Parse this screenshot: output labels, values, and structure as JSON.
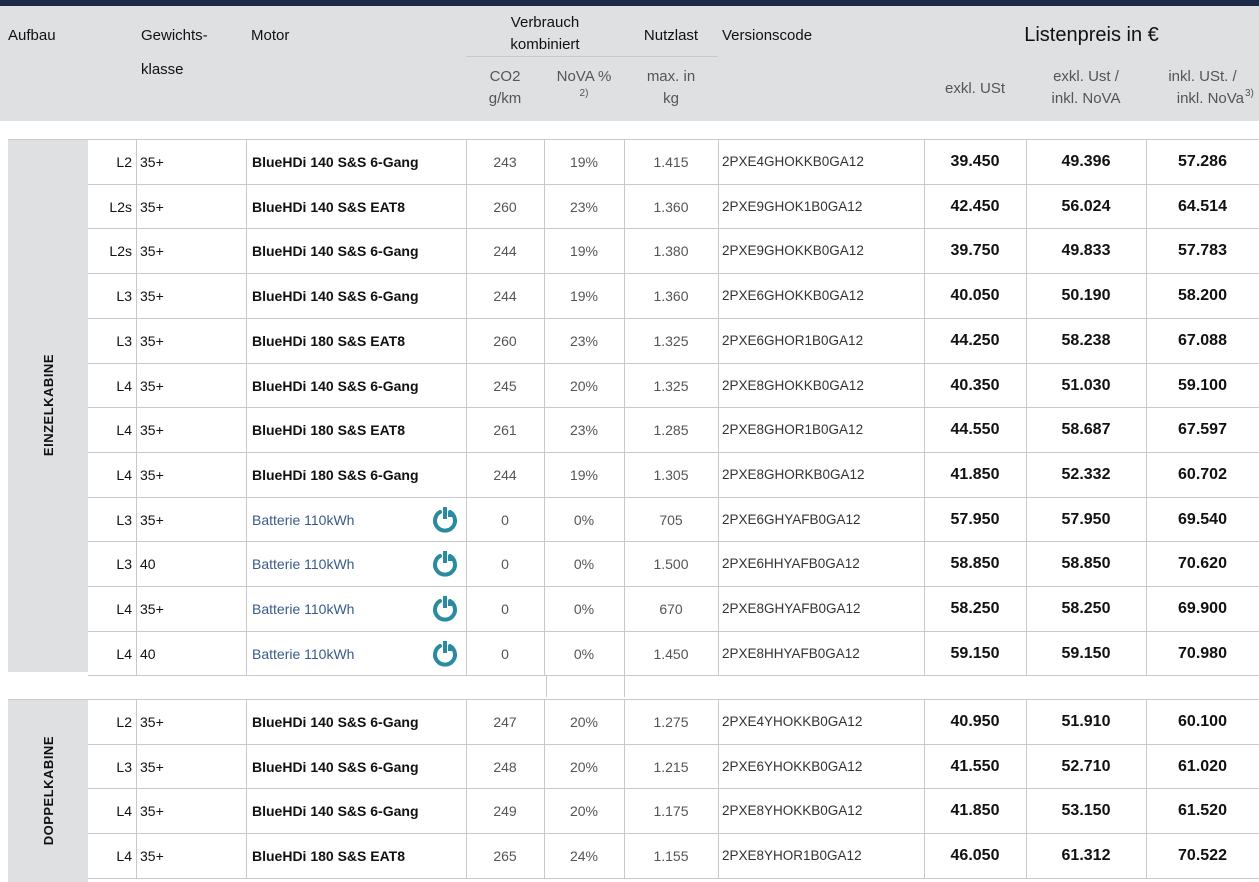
{
  "header": {
    "aufbau": "Aufbau",
    "gewichtsklasse_1": "Gewichts-",
    "gewichtsklasse_2": "klasse",
    "motor": "Motor",
    "verbrauch_1": "Verbrauch",
    "verbrauch_2": "kombiniert",
    "co2_1": "CO2",
    "co2_2": "g/km",
    "nova_1": "NoVA %",
    "nova_sup": "2)",
    "nutzlast": "Nutzlast",
    "nutzlast_sub_1": "max. in",
    "nutzlast_sub_2": "kg",
    "versionscode": "Versionscode",
    "listenpreis": "Listenpreis in €",
    "exkl_ust": "exkl. USt",
    "exkl_ust_inkl_nova_1": "exkl. Ust /",
    "exkl_ust_inkl_nova_2": "inkl. NoVA",
    "inkl_ust_inkl_nova_1": "inkl. USt. /",
    "inkl_ust_inkl_nova_2": "inkl. NoVa",
    "inkl_sup": "3)"
  },
  "sections": [
    {
      "label": "EINZELKABINE",
      "rows": [
        {
          "len": "L2",
          "class": "35+",
          "motor": "BlueHDi 140 S&S 6-Gang",
          "electric": false,
          "co2": "243",
          "nova": "19%",
          "payload": "1.415",
          "code": "2PXE4GHOKKB0GA12",
          "p1": "39.450",
          "p2": "49.396",
          "p3": "57.286"
        },
        {
          "len": "L2s",
          "class": "35+",
          "motor": "BlueHDi 140 S&S EAT8",
          "electric": false,
          "co2": "260",
          "nova": "23%",
          "payload": "1.360",
          "code": "2PXE9GHOK1B0GA12",
          "p1": "42.450",
          "p2": "56.024",
          "p3": "64.514"
        },
        {
          "len": "L2s",
          "class": "35+",
          "motor": "BlueHDi 140 S&S 6-Gang",
          "electric": false,
          "co2": "244",
          "nova": "19%",
          "payload": "1.380",
          "code": "2PXE9GHOKKB0GA12",
          "p1": "39.750",
          "p2": "49.833",
          "p3": "57.783"
        },
        {
          "len": "L3",
          "class": "35+",
          "motor": "BlueHDi 140 S&S 6-Gang",
          "electric": false,
          "co2": "244",
          "nova": "19%",
          "payload": "1.360",
          "code": "2PXE6GHOKKB0GA12",
          "p1": "40.050",
          "p2": "50.190",
          "p3": "58.200"
        },
        {
          "len": "L3",
          "class": "35+",
          "motor": "BlueHDi 180 S&S EAT8",
          "electric": false,
          "co2": "260",
          "nova": "23%",
          "payload": "1.325",
          "code": "2PXE6GHOR1B0GA12",
          "p1": "44.250",
          "p2": "58.238",
          "p3": "67.088"
        },
        {
          "len": "L4",
          "class": "35+",
          "motor": "BlueHDi 140 S&S 6-Gang",
          "electric": false,
          "co2": "245",
          "nova": "20%",
          "payload": "1.325",
          "code": "2PXE8GHOKKB0GA12",
          "p1": "40.350",
          "p2": "51.030",
          "p3": "59.100"
        },
        {
          "len": "L4",
          "class": "35+",
          "motor": "BlueHDi 180 S&S EAT8",
          "electric": false,
          "co2": "261",
          "nova": "23%",
          "payload": "1.285",
          "code": "2PXE8GHOR1B0GA12",
          "p1": "44.550",
          "p2": "58.687",
          "p3": "67.597"
        },
        {
          "len": "L4",
          "class": "35+",
          "motor": "BlueHDi 180 S&S 6-Gang",
          "electric": false,
          "co2": "244",
          "nova": "19%",
          "payload": "1.305",
          "code": "2PXE8GHORKB0GA12",
          "p1": "41.850",
          "p2": "52.332",
          "p3": "60.702"
        },
        {
          "len": "L3",
          "class": "35+",
          "motor": "Batterie 110kWh",
          "electric": true,
          "co2": "0",
          "nova": "0%",
          "payload": "705",
          "code": "2PXE6GHYAFB0GA12",
          "p1": "57.950",
          "p2": "57.950",
          "p3": "69.540"
        },
        {
          "len": "L3",
          "class": "40",
          "motor": "Batterie 110kWh",
          "electric": true,
          "co2": "0",
          "nova": "0%",
          "payload": "1.500",
          "code": "2PXE6HHYAFB0GA12",
          "p1": "58.850",
          "p2": "58.850",
          "p3": "70.620"
        },
        {
          "len": "L4",
          "class": "35+",
          "motor": "Batterie 110kWh",
          "electric": true,
          "co2": "0",
          "nova": "0%",
          "payload": "670",
          "code": "2PXE8GHYAFB0GA12",
          "p1": "58.250",
          "p2": "58.250",
          "p3": "69.900"
        },
        {
          "len": "L4",
          "class": "40",
          "motor": "Batterie 110kWh",
          "electric": true,
          "co2": "0",
          "nova": "0%",
          "payload": "1.450",
          "code": "2PXE8HHYAFB0GA12",
          "p1": "59.150",
          "p2": "59.150",
          "p3": "70.980"
        }
      ]
    },
    {
      "label": "DOPPELKABINE",
      "rows": [
        {
          "len": "L2",
          "class": "35+",
          "motor": "BlueHDi 140 S&S 6-Gang",
          "electric": false,
          "co2": "247",
          "nova": "20%",
          "payload": "1.275",
          "code": "2PXE4YHOKKB0GA12",
          "p1": "40.950",
          "p2": "51.910",
          "p3": "60.100"
        },
        {
          "len": "L3",
          "class": "35+",
          "motor": "BlueHDi 140 S&S 6-Gang",
          "electric": false,
          "co2": "248",
          "nova": "20%",
          "payload": "1.215",
          "code": "2PXE6YHOKKB0GA12",
          "p1": "41.550",
          "p2": "52.710",
          "p3": "61.020"
        },
        {
          "len": "L4",
          "class": "35+",
          "motor": "BlueHDi 140 S&S 6-Gang",
          "electric": false,
          "co2": "249",
          "nova": "20%",
          "payload": "1.175",
          "code": "2PXE8YHOKKB0GA12",
          "p1": "41.850",
          "p2": "53.150",
          "p3": "61.520"
        },
        {
          "len": "L4",
          "class": "35+",
          "motor": "BlueHDi 180 S&S EAT8",
          "electric": false,
          "co2": "265",
          "nova": "24%",
          "payload": "1.155",
          "code": "2PXE8YHOR1B0GA12",
          "p1": "46.050",
          "p2": "61.312",
          "p3": "70.522"
        }
      ]
    }
  ],
  "icons": {
    "electric": "ev-plug-icon"
  },
  "colors": {
    "header_bg": "#dfe0e1",
    "top_bar": "#1c2b45",
    "electric_text": "#3a5a8c",
    "ev_icon": "#2a8aa0"
  }
}
